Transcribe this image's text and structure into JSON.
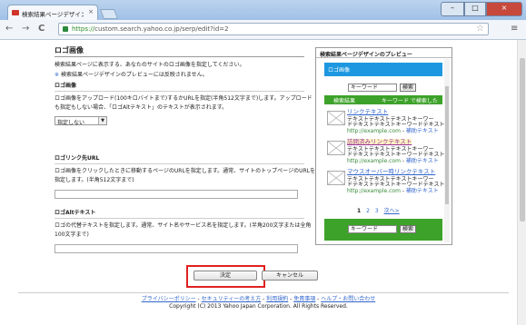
{
  "browser": {
    "tab_title": "検索結果ページデザインの設",
    "tab_close": "×",
    "url_domain": "https://",
    "url_rest": "custom.search.yahoo.co.jp/serp/edit?id=2",
    "back": "←",
    "forward": "→",
    "reload": "C",
    "star": "☆",
    "menu": "≡",
    "win_min": "–",
    "win_max": "□",
    "win_close": "×"
  },
  "logo_section": {
    "title": "ロゴ画像",
    "desc": "検索結果ページに表示する、あなたのサイトのロゴ画像を指定してください。",
    "note_mark": "※",
    "note": "検索結果ページデザインのプレビューには反映されません。",
    "sub_title": "ロゴ画像",
    "sub_desc1": "ロゴ画像をアップロード(100キロバイトまで)するかURLを指定(半角512文字まで)します。アップロード",
    "sub_desc2": "も指定もしない場合、「ロゴAltテキスト」のテキストが表示されます。",
    "select_value": "指定しない",
    "select_arrow": "▼"
  },
  "link_section": {
    "title": "ロゴリンク先URL",
    "desc1": "ロゴ画像をクリックしたときに移動するページのURLを指定します。通常、サイトのトップページのURLを",
    "desc2": "指定します。(半角512文字まで)"
  },
  "alt_section": {
    "title": "ロゴAltテキスト",
    "desc1": "ロゴの代替テキストを指定します。通常、サイト名やサービス名を指定します。(半角200文字または全角",
    "desc2": "100文字まで)"
  },
  "preview": {
    "title": "検索結果ページデザインのプレビュー",
    "logo_text": "ロゴ画像",
    "search_value": "キーワード",
    "search_button": "検索",
    "bar_left": "検索結果",
    "bar_right": "キーワード で検索した結果",
    "results": [
      {
        "title": "リンクテキスト",
        "l1": "テキストテキストテキストキーワー",
        "l2": "ドテキストテキストキーワードテキスト",
        "url": "http://example.com",
        "sep": " - ",
        "sub": "補助テキスト"
      },
      {
        "title": "訪問済みリンクテキスト",
        "l1": "テキストテキストテキストキーワー",
        "l2": "ドテキストテキストキーワードテキスト",
        "url": "http://example.com",
        "sep": " - ",
        "sub": "補助テキスト"
      },
      {
        "title": "マウスオーバー時リンクテキスト",
        "l1": "テキストテキストテキストキーワー",
        "l2": "ドテキストテキストキーワードテキスト",
        "url": "http://example.com",
        "sep": " - ",
        "sub": "補助テキスト"
      }
    ],
    "pager": [
      "1",
      "2",
      "3",
      "次へ>"
    ],
    "footer_search_value": "キーワード",
    "footer_search_button": "検索"
  },
  "buttons": {
    "ok": "決定",
    "cancel": "キャンセル"
  },
  "footer": {
    "links": [
      "プライバシーポリシー",
      "セキュリティーの考え方",
      "利用規約",
      "免責事項",
      "ヘルプ・お問い合わせ"
    ],
    "separator": " - ",
    "copyright": "Copyright (C) 2013 Yahoo Japan Corporation. All Rights Reserved."
  }
}
